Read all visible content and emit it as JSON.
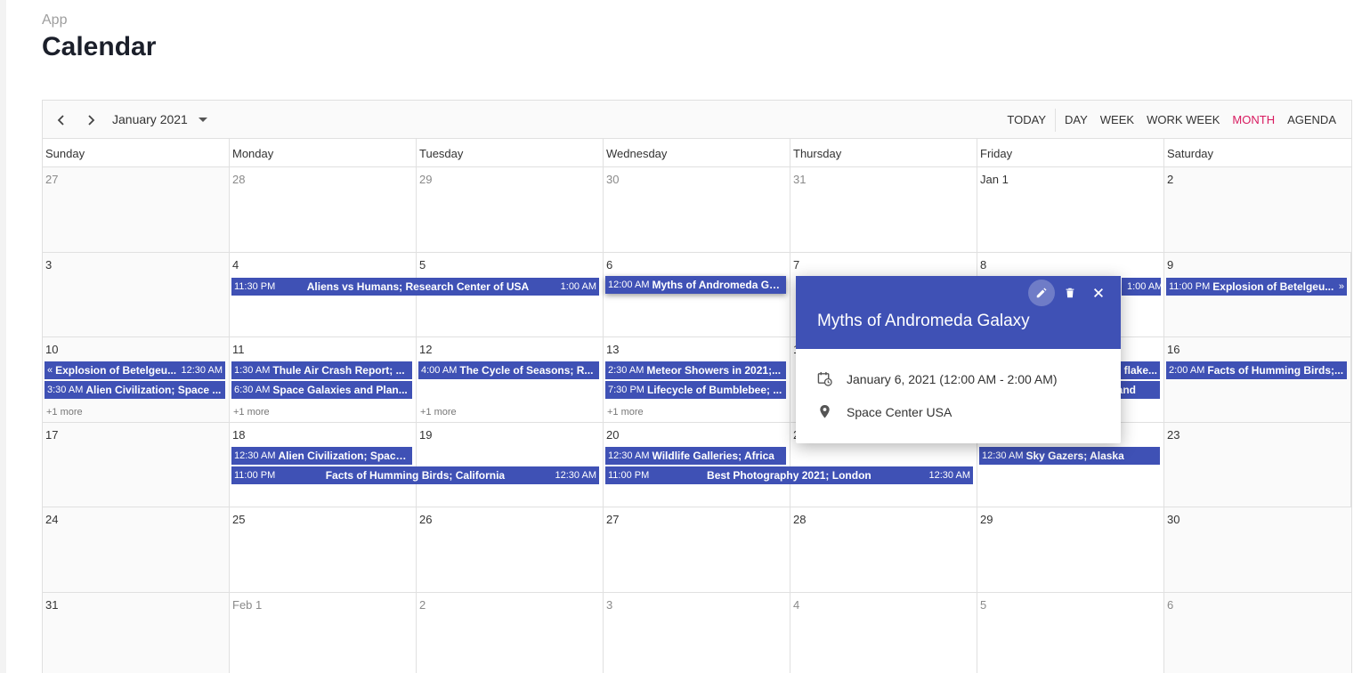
{
  "app": {
    "breadcrumb": "App",
    "title": "Calendar"
  },
  "toolbar": {
    "date_range": "January 2021",
    "views": [
      "TODAY",
      "DAY",
      "WEEK",
      "WORK WEEK",
      "MONTH",
      "AGENDA"
    ],
    "active_view": "MONTH"
  },
  "days_of_week": [
    "Sunday",
    "Monday",
    "Tuesday",
    "Wednesday",
    "Thursday",
    "Friday",
    "Saturday"
  ],
  "weeks": [
    [
      "27",
      "28",
      "29",
      "30",
      "31",
      "Jan 1",
      "2"
    ],
    [
      "3",
      "4",
      "5",
      "6",
      "7",
      "8",
      "9"
    ],
    [
      "10",
      "11",
      "12",
      "13",
      "14",
      "15",
      "16"
    ],
    [
      "17",
      "18",
      "19",
      "20",
      "21",
      "22",
      "23"
    ],
    [
      "24",
      "25",
      "26",
      "27",
      "28",
      "29",
      "30"
    ],
    [
      "31",
      "Feb 1",
      "2",
      "3",
      "4",
      "5",
      "6"
    ]
  ],
  "more_label": "+1 more",
  "events": {
    "e1": {
      "start": "11:30 PM",
      "subject": "Aliens vs Humans; Research Center of USA",
      "end": "1:00 AM"
    },
    "e2": {
      "start": "12:00 AM",
      "subject": "Myths of Andromeda Ga..."
    },
    "e3": {
      "end": "1:00 AM"
    },
    "e4": {
      "start": "11:00 PM",
      "subject": "Explosion of Betelgeu...",
      "arrow": "»"
    },
    "e5": {
      "arrow": "«",
      "subject": "Explosion of Betelgeu...",
      "end": "12:30 AM"
    },
    "e6": {
      "start": "3:30 AM",
      "subject": "Alien Civilization; Space ..."
    },
    "e7": {
      "start": "1:30 AM",
      "subject": "Thule Air Crash Report; ..."
    },
    "e8": {
      "start": "6:30 AM",
      "subject": "Space Galaxies and Plan..."
    },
    "e9": {
      "start": "4:00 AM",
      "subject": "The Cycle of Seasons; R..."
    },
    "e10": {
      "start": "2:30 AM",
      "subject": "Meteor Showers in 2021;..."
    },
    "e11": {
      "start": "7:30 PM",
      "subject": "Lifecycle of Bumblebee; ..."
    },
    "e12": {
      "subject": "flake..."
    },
    "e13": {
      "subject": "and"
    },
    "e14": {
      "start": "2:00 AM",
      "subject": "Facts of Humming Birds;..."
    },
    "e15": {
      "start": "12:30 AM",
      "subject": "Alien Civilization; Space..."
    },
    "e16": {
      "start": "11:00 PM",
      "subject": "Facts of Humming Birds; California",
      "end": "12:30 AM"
    },
    "e17": {
      "start": "12:30 AM",
      "subject": "Wildlife Galleries; Africa"
    },
    "e18": {
      "start": "11:00 PM",
      "subject": "Best Photography 2021; London",
      "end": "12:30 AM"
    },
    "e19": {
      "start": "12:30 AM",
      "subject": "Sky Gazers; Alaska"
    }
  },
  "popup": {
    "title": "Myths of Andromeda Galaxy",
    "datetime": "January 6, 2021 (12:00 AM - 2:00 AM)",
    "location": "Space Center USA"
  },
  "colors": {
    "event": "#3f51b5",
    "active_view": "#d81b60"
  }
}
